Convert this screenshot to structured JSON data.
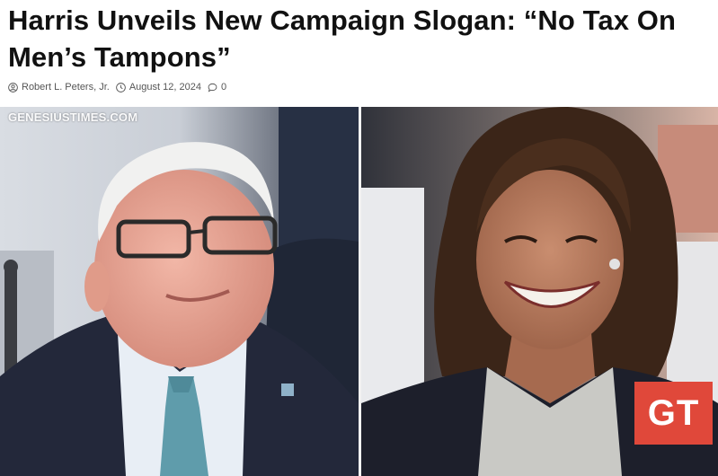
{
  "article": {
    "headline": "Harris Unveils New Campaign Slogan: “No Tax On Men’s Tampons”",
    "author": "Robert L. Peters, Jr.",
    "date": "August 12, 2024",
    "comments": "0"
  },
  "image": {
    "watermark": "GENESIUSTIMES.COM",
    "badge": "GT",
    "badge_color": "#e0483a"
  },
  "icons": {
    "author": "user-circle-icon",
    "date": "clock-icon",
    "comments": "comment-bubble-icon"
  }
}
